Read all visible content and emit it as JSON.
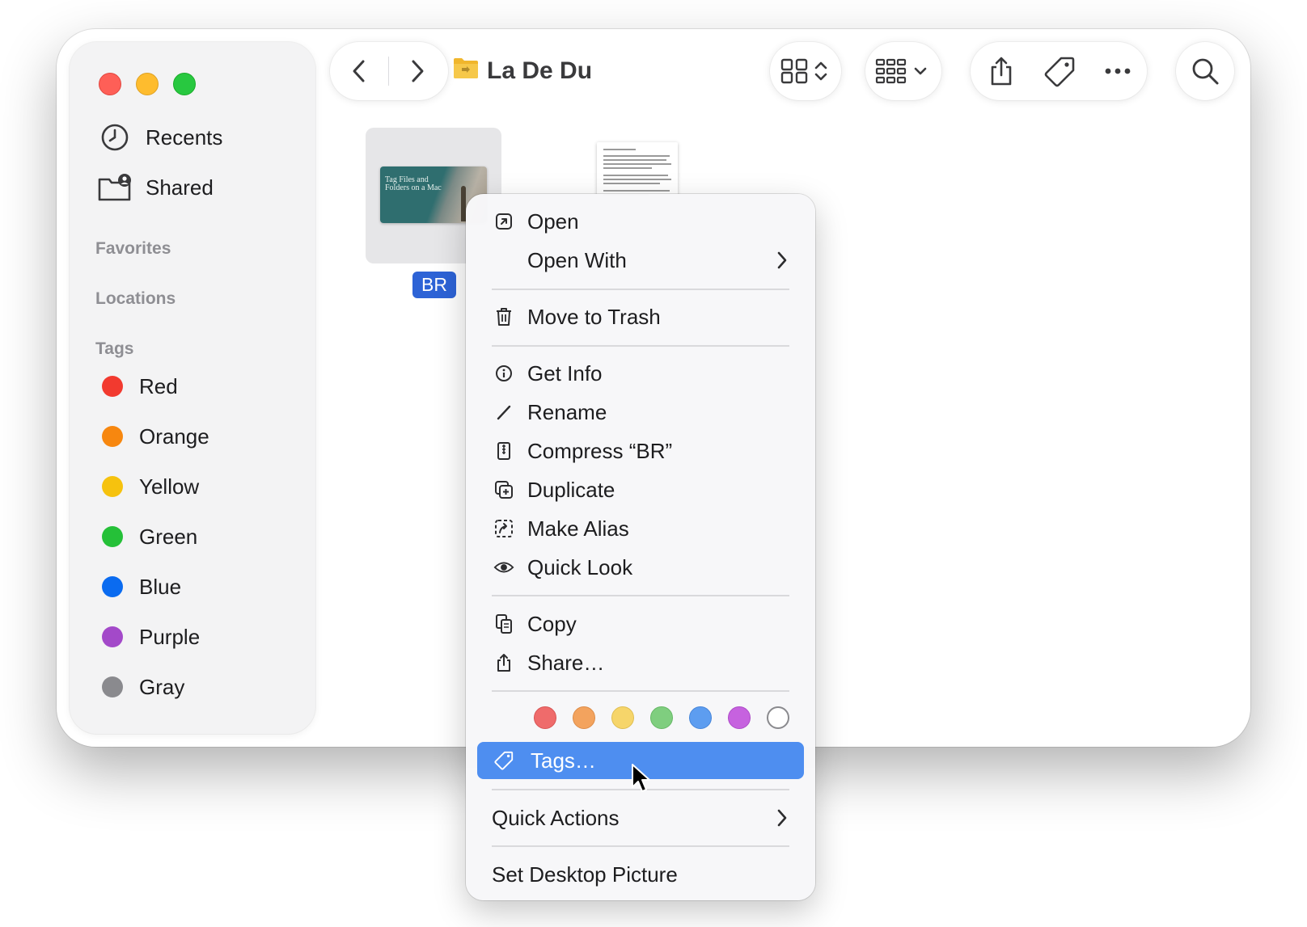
{
  "window": {
    "title": "La De Du"
  },
  "sidebar": {
    "items": [
      {
        "label": "Recents",
        "icon": "clock-icon"
      },
      {
        "label": "Shared",
        "icon": "shared-folder-icon"
      }
    ],
    "sections": {
      "favorites": "Favorites",
      "locations": "Locations",
      "tags": "Tags"
    },
    "tags": [
      {
        "label": "Red",
        "color": "#f23a2f"
      },
      {
        "label": "Orange",
        "color": "#f7870f"
      },
      {
        "label": "Yellow",
        "color": "#f6c20e"
      },
      {
        "label": "Green",
        "color": "#25c038"
      },
      {
        "label": "Blue",
        "color": "#0a6bf0"
      },
      {
        "label": "Purple",
        "color": "#a349c9"
      },
      {
        "label": "Gray",
        "color": "#8a8a8e"
      }
    ]
  },
  "toolbar": {
    "icons": [
      "back-icon",
      "forward-icon",
      "folder-icon",
      "icon-view-icon",
      "group-view-icon",
      "share-icon",
      "tag-icon",
      "more-icon",
      "search-icon"
    ]
  },
  "files": [
    {
      "name": "BR",
      "thumbnail_text": "Tag Files and Folders on a Mac",
      "selected": true
    },
    {
      "name": "",
      "thumbnail": "text-document"
    }
  ],
  "context_menu": {
    "items": {
      "open": "Open",
      "open_with": "Open With",
      "move_to_trash": "Move to Trash",
      "get_info": "Get Info",
      "rename": "Rename",
      "compress": "Compress “BR”",
      "duplicate": "Duplicate",
      "make_alias": "Make Alias",
      "quick_look": "Quick Look",
      "copy": "Copy",
      "share": "Share…",
      "tags": "Tags…",
      "quick_actions": "Quick Actions",
      "set_desktop_picture": "Set Desktop Picture"
    },
    "highlighted": "Tags…",
    "tag_colors": [
      "#ef6b6b",
      "#f3a35e",
      "#f6d56a",
      "#7fce7f",
      "#5d9df0",
      "#c662df",
      "none"
    ]
  }
}
